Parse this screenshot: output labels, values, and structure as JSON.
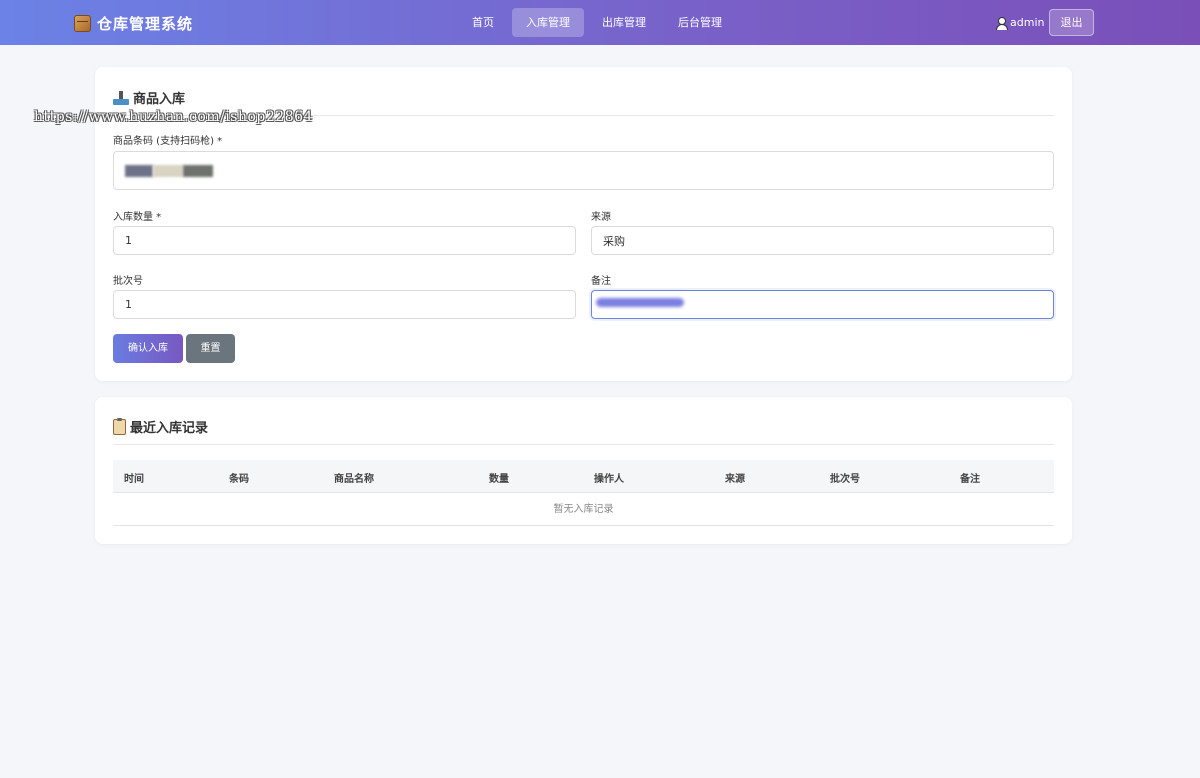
{
  "header": {
    "app_title": "仓库管理系统",
    "nav": [
      {
        "label": "首页",
        "active": false
      },
      {
        "label": "入库管理",
        "active": true
      },
      {
        "label": "出库管理",
        "active": false
      },
      {
        "label": "后台管理",
        "active": false
      }
    ],
    "username": "admin",
    "logout_label": "退出"
  },
  "inbound_form": {
    "title": "商品入库",
    "barcode_label": "商品条码 (支持扫码枪) *",
    "quantity_label": "入库数量 *",
    "quantity_value": "1",
    "source_label": "来源",
    "source_value": "采购",
    "batch_label": "批次号",
    "batch_value": "1",
    "note_label": "备注",
    "submit_label": "确认入库",
    "reset_label": "重置"
  },
  "records": {
    "title": "最近入库记录",
    "columns": [
      "时间",
      "条码",
      "商品名称",
      "数量",
      "操作人",
      "来源",
      "批次号",
      "备注"
    ],
    "empty_text": "暂无入库记录"
  },
  "watermark": "https://www.huzhan.com/ishop22864",
  "colors": {
    "header_start": "#6b82e6",
    "header_end": "#7a4fb8",
    "primary_button": "#6a7ce0",
    "secondary_button": "#6b757d",
    "page_background": "#f4f6fa"
  }
}
